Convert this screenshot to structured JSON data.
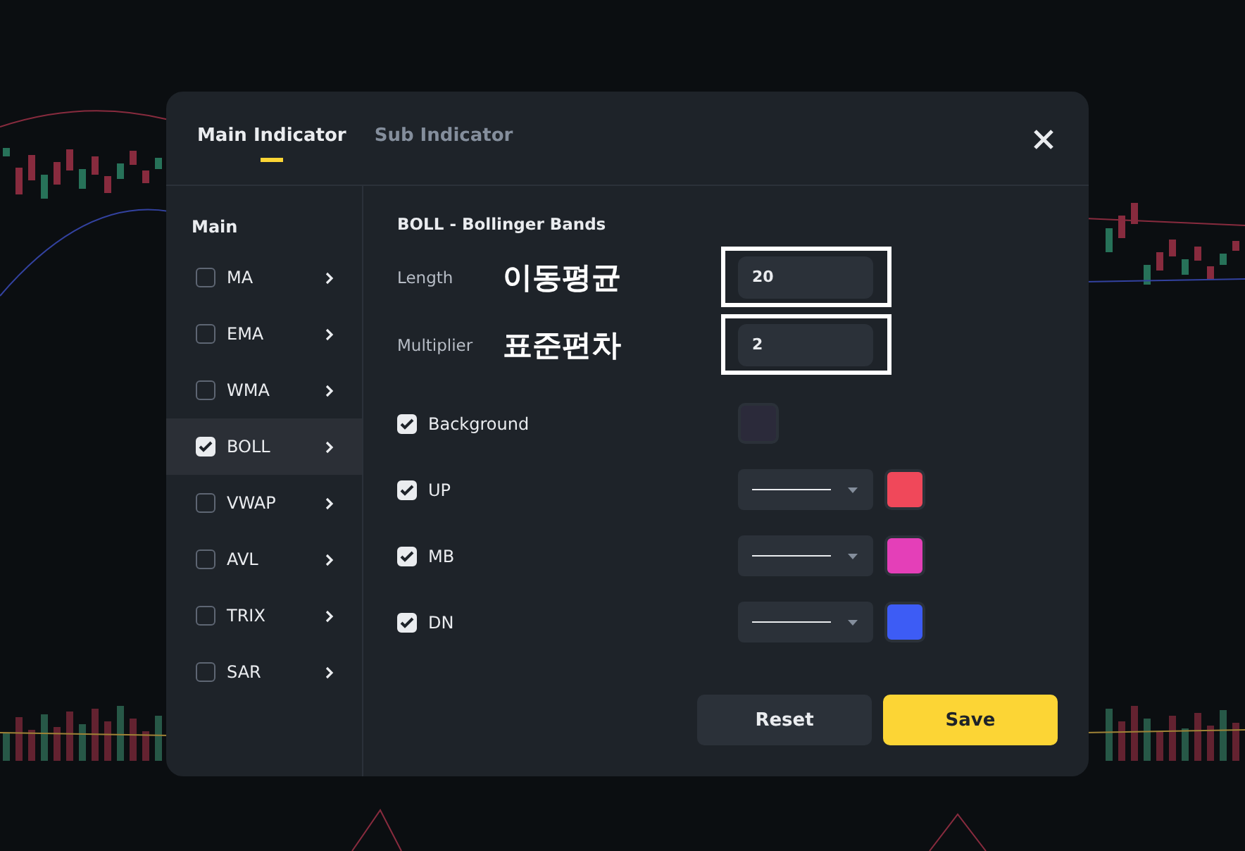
{
  "tabs": [
    {
      "label": "Main Indicator",
      "selected": true
    },
    {
      "label": "Sub Indicator",
      "selected": false
    }
  ],
  "sidebar": {
    "heading": "Main",
    "items": [
      {
        "label": "MA",
        "checked": false,
        "selected": false
      },
      {
        "label": "EMA",
        "checked": false,
        "selected": false
      },
      {
        "label": "WMA",
        "checked": false,
        "selected": false
      },
      {
        "label": "BOLL",
        "checked": true,
        "selected": true
      },
      {
        "label": "VWAP",
        "checked": false,
        "selected": false
      },
      {
        "label": "AVL",
        "checked": false,
        "selected": false
      },
      {
        "label": "TRIX",
        "checked": false,
        "selected": false
      },
      {
        "label": "SAR",
        "checked": false,
        "selected": false
      }
    ]
  },
  "panel": {
    "title": "BOLL - Bollinger Bands",
    "params": [
      {
        "label": "Length",
        "annotation": "이동평균",
        "value": "20"
      },
      {
        "label": "Multiplier",
        "annotation": "표준편차",
        "value": "2"
      }
    ],
    "options": [
      {
        "kind": "fill",
        "label": "Background",
        "checked": true,
        "color": "#2b2a3a"
      },
      {
        "kind": "line",
        "label": "UP",
        "checked": true,
        "color": "#f0485a"
      },
      {
        "kind": "line",
        "label": "MB",
        "checked": true,
        "color": "#e43fb8"
      },
      {
        "kind": "line",
        "label": "DN",
        "checked": true,
        "color": "#3d5cf5"
      }
    ]
  },
  "buttons": [
    {
      "label": "Reset",
      "kind": "secondary"
    },
    {
      "label": "Save",
      "kind": "primary"
    }
  ]
}
